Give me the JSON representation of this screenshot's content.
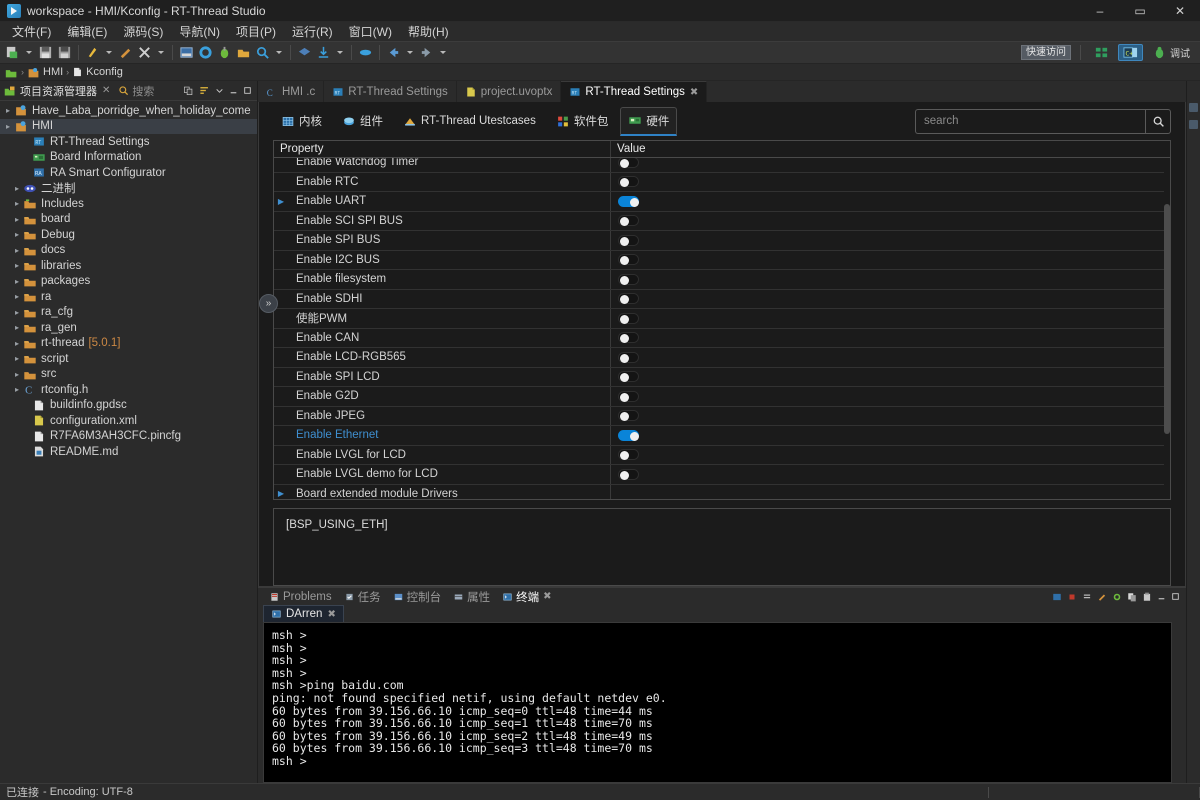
{
  "window": {
    "title": "workspace - HMI/Kconfig - RT-Thread Studio",
    "app_icon": "rt-thread-studio-icon",
    "minimize": "–",
    "maximize": "▭",
    "close": "✕"
  },
  "menubar": {
    "items": [
      {
        "label": "文件(F)"
      },
      {
        "label": "编辑(E)"
      },
      {
        "label": "源码(S)"
      },
      {
        "label": "导航(N)"
      },
      {
        "label": "项目(P)"
      },
      {
        "label": "运行(R)"
      },
      {
        "label": "窗口(W)"
      },
      {
        "label": "帮助(H)"
      }
    ]
  },
  "toolbar": {
    "quick_access_value": "快速访问",
    "perspectives": [
      {
        "label": "",
        "icon": "grid-perspective-icon",
        "active": false
      },
      {
        "label": "",
        "icon": "cpp-perspective-icon",
        "active": true
      },
      {
        "label": "调试",
        "icon": "debug-perspective-icon",
        "active": false
      }
    ]
  },
  "breadcrumb": {
    "items": [
      {
        "label": "",
        "icon": "workspace-icon"
      },
      {
        "label": "HMI",
        "icon": "project-icon"
      },
      {
        "label": "Kconfig",
        "icon": "file-icon"
      }
    ],
    "separator": "›"
  },
  "explorer": {
    "title": "项目资源管理器",
    "close_label": "✕",
    "search_label": "搜索",
    "tools": [
      {
        "name": "link-with-editor-icon"
      },
      {
        "name": "sort-icon"
      },
      {
        "name": "view-menu-icon"
      },
      {
        "name": "minimize-icon"
      },
      {
        "name": "maximize-icon"
      }
    ],
    "tree": [
      {
        "label": "Have_Laba_porridge_when_holiday_come",
        "icon": "project-icon",
        "indent": 0,
        "arrow": true,
        "selected": false
      },
      {
        "label": "HMI",
        "icon": "project-icon",
        "indent": 0,
        "arrow": true,
        "selected": true
      },
      {
        "label": "RT-Thread Settings",
        "icon": "rtthread-settings-icon",
        "indent": 2,
        "arrow": false,
        "selected": false
      },
      {
        "label": "Board Information",
        "icon": "board-info-icon",
        "indent": 2,
        "arrow": false,
        "selected": false
      },
      {
        "label": "RA Smart Configurator",
        "icon": "ra-configurator-icon",
        "indent": 2,
        "arrow": false,
        "selected": false
      },
      {
        "label": "二进制",
        "icon": "binaries-icon",
        "indent": 1,
        "arrow": true,
        "selected": false
      },
      {
        "label": "Includes",
        "icon": "includes-folder-icon",
        "indent": 1,
        "arrow": true,
        "selected": false
      },
      {
        "label": "board",
        "icon": "folder-icon",
        "indent": 1,
        "arrow": true,
        "selected": false
      },
      {
        "label": "Debug",
        "icon": "folder-icon",
        "indent": 1,
        "arrow": true,
        "selected": false
      },
      {
        "label": "docs",
        "icon": "folder-icon",
        "indent": 1,
        "arrow": true,
        "selected": false
      },
      {
        "label": "libraries",
        "icon": "folder-icon",
        "indent": 1,
        "arrow": true,
        "selected": false
      },
      {
        "label": "packages",
        "icon": "folder-icon",
        "indent": 1,
        "arrow": true,
        "selected": false
      },
      {
        "label": "ra",
        "icon": "folder-icon",
        "indent": 1,
        "arrow": true,
        "selected": false
      },
      {
        "label": "ra_cfg",
        "icon": "folder-icon",
        "indent": 1,
        "arrow": true,
        "selected": false
      },
      {
        "label": "ra_gen",
        "icon": "folder-icon",
        "indent": 1,
        "arrow": true,
        "selected": false
      },
      {
        "label": "rt-thread",
        "version": "[5.0.1]",
        "icon": "folder-icon",
        "indent": 1,
        "arrow": true,
        "selected": false
      },
      {
        "label": "script",
        "icon": "folder-icon",
        "indent": 1,
        "arrow": true,
        "selected": false
      },
      {
        "label": "src",
        "icon": "folder-src-icon",
        "indent": 1,
        "arrow": true,
        "selected": false
      },
      {
        "label": "rtconfig.h",
        "icon": "c-header-icon",
        "indent": 1,
        "arrow": true,
        "selected": false
      },
      {
        "label": "buildinfo.gpdsc",
        "icon": "file-icon",
        "indent": 2,
        "arrow": false,
        "selected": false
      },
      {
        "label": "configuration.xml",
        "icon": "xml-file-icon",
        "indent": 2,
        "arrow": false,
        "selected": false
      },
      {
        "label": "R7FA6M3AH3CFC.pincfg",
        "icon": "file-icon",
        "indent": 2,
        "arrow": false,
        "selected": false
      },
      {
        "label": "README.md",
        "icon": "markdown-file-icon",
        "indent": 2,
        "arrow": false,
        "selected": false
      }
    ]
  },
  "collapse_handle": {
    "label": "»"
  },
  "editor": {
    "tabs": [
      {
        "label": "HMI .c",
        "icon": "c-file-icon",
        "active": false,
        "closable": false
      },
      {
        "label": "RT-Thread Settings",
        "icon": "rtthread-settings-icon",
        "active": false,
        "closable": false
      },
      {
        "label": "project.uvoptx",
        "icon": "xml-file-icon",
        "active": false,
        "closable": false
      },
      {
        "label": "RT-Thread Settings",
        "icon": "rtthread-settings-icon",
        "active": true,
        "closable": true
      }
    ],
    "tab_close": "✖",
    "categories": [
      {
        "label": "内核",
        "icon": "kernel-icon",
        "active": false
      },
      {
        "label": "组件",
        "icon": "components-icon",
        "active": false
      },
      {
        "label": "RT-Thread Utestcases",
        "icon": "utestcases-icon",
        "active": false
      },
      {
        "label": "软件包",
        "icon": "packages-icon",
        "active": false
      },
      {
        "label": "硬件",
        "icon": "hardware-icon",
        "active": true
      }
    ],
    "search": {
      "placeholder": "search",
      "value": "",
      "button_icon": "search-icon"
    },
    "table": {
      "headers": {
        "property": "Property",
        "value": "Value"
      },
      "rows": [
        {
          "property": "Enable Watchdog Timer",
          "value": false,
          "expandable": false,
          "link": false
        },
        {
          "property": "Enable RTC",
          "value": false,
          "expandable": false,
          "link": false
        },
        {
          "property": "Enable UART",
          "value": true,
          "expandable": true,
          "link": false
        },
        {
          "property": "Enable SCI SPI BUS",
          "value": false,
          "expandable": false,
          "link": false
        },
        {
          "property": "Enable SPI BUS",
          "value": false,
          "expandable": false,
          "link": false
        },
        {
          "property": "Enable I2C BUS",
          "value": false,
          "expandable": false,
          "link": false
        },
        {
          "property": "Enable filesystem",
          "value": false,
          "expandable": false,
          "link": false
        },
        {
          "property": "Enable SDHI",
          "value": false,
          "expandable": false,
          "link": false
        },
        {
          "property": "使能PWM",
          "value": false,
          "expandable": false,
          "link": false
        },
        {
          "property": "Enable CAN",
          "value": false,
          "expandable": false,
          "link": false
        },
        {
          "property": "Enable LCD-RGB565",
          "value": false,
          "expandable": false,
          "link": false
        },
        {
          "property": "Enable SPI LCD",
          "value": false,
          "expandable": false,
          "link": false
        },
        {
          "property": "Enable G2D",
          "value": false,
          "expandable": false,
          "link": false
        },
        {
          "property": "Enable JPEG",
          "value": false,
          "expandable": false,
          "link": false
        },
        {
          "property": "Enable Ethernet",
          "value": true,
          "expandable": false,
          "link": true
        },
        {
          "property": "Enable LVGL for LCD",
          "value": false,
          "expandable": false,
          "link": false
        },
        {
          "property": "Enable LVGL demo for LCD",
          "value": false,
          "expandable": false,
          "link": false
        },
        {
          "property": "Board extended module Drivers",
          "value": null,
          "expandable": true,
          "link": false
        }
      ]
    },
    "description": "[BSP_USING_ETH]"
  },
  "bottom_panel": {
    "tabs": [
      {
        "label": "Problems",
        "icon": "problems-icon",
        "active": false,
        "closable": false
      },
      {
        "label": "任务",
        "icon": "tasks-icon",
        "active": false,
        "closable": false
      },
      {
        "label": "控制台",
        "icon": "console-icon",
        "active": false,
        "closable": false
      },
      {
        "label": "属性",
        "icon": "properties-icon",
        "active": false,
        "closable": false
      },
      {
        "label": "终端",
        "icon": "terminal-icon",
        "active": true,
        "closable": true
      }
    ],
    "tab_close": "✖",
    "tools": [
      {
        "name": "terminal-new-icon"
      },
      {
        "name": "terminal-stop-icon"
      },
      {
        "name": "terminal-scroll-lock-icon"
      },
      {
        "name": "terminal-clear-icon"
      },
      {
        "name": "terminal-settings-icon"
      },
      {
        "name": "copy-icon"
      },
      {
        "name": "paste-icon"
      },
      {
        "name": "minimize-icon"
      },
      {
        "name": "maximize-icon"
      }
    ],
    "sub_tabs": [
      {
        "label": "DArren",
        "icon": "terminal-icon",
        "active": true,
        "closable": true
      }
    ],
    "terminal_output": "msh >\nmsh >\nmsh >\nmsh >\nmsh >ping baidu.com\nping: not found specified netif, using default netdev e0.\n60 bytes from 39.156.66.10 icmp_seq=0 ttl=48 time=44 ms\n60 bytes from 39.156.66.10 icmp_seq=1 ttl=48 time=70 ms\n60 bytes from 39.156.66.10 icmp_seq=2 ttl=48 time=49 ms\n60 bytes from 39.156.66.10 icmp_seq=3 ttl=48 time=70 ms\nmsh >"
  },
  "statusbar": {
    "connection": "已连接",
    "encoding": "- Encoding: UTF-8"
  },
  "colors": {
    "accent_blue": "#0a84d8",
    "link_blue": "#3f8fd0",
    "folder_orange": "#d4923c",
    "bg_dark": "#2b2b2b",
    "editor_bg": "#1b1b1b",
    "terminal_bg": "#000000"
  }
}
